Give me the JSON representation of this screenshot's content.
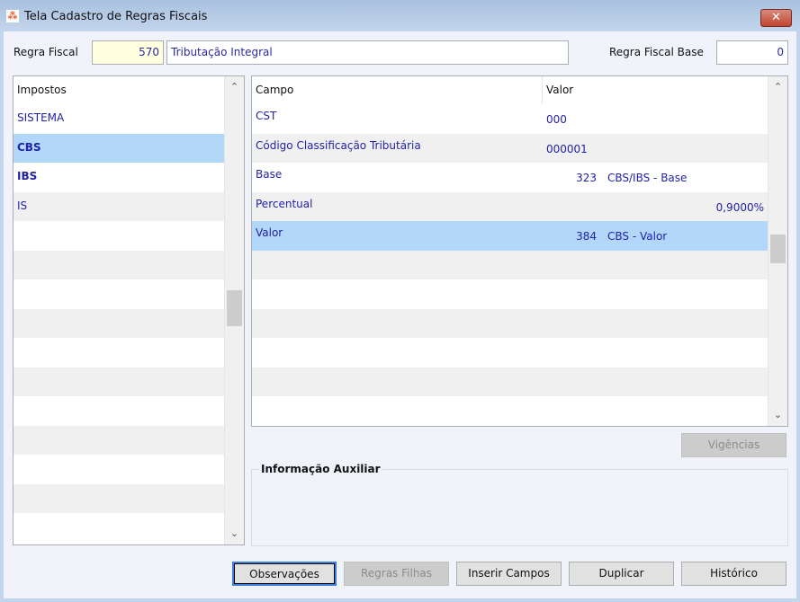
{
  "window": {
    "title": "Tela Cadastro de Regras Fiscais",
    "close_label": "✕"
  },
  "header": {
    "regra_fiscal_label": "Regra Fiscal",
    "regra_fiscal_code": "570",
    "regra_fiscal_desc": "Tributação Integral",
    "regra_base_label": "Regra Fiscal Base",
    "regra_base_value": "0"
  },
  "impostos": {
    "header": "Impostos",
    "items": [
      {
        "label": "SISTEMA",
        "bold": false
      },
      {
        "label": "CBS",
        "bold": true,
        "selected": true
      },
      {
        "label": "IBS",
        "bold": true
      },
      {
        "label": "IS",
        "bold": false
      }
    ]
  },
  "campos": {
    "col_campo": "Campo",
    "col_valor": "Valor",
    "rows": [
      {
        "campo": "CST",
        "valor": "000",
        "num": "",
        "desc": ""
      },
      {
        "campo": "Código Classificação Tributária",
        "valor": "000001",
        "num": "",
        "desc": ""
      },
      {
        "campo": "Base",
        "valor": "",
        "num": "323",
        "desc": "CBS/IBS - Base"
      },
      {
        "campo": "Percentual",
        "valor": "",
        "num": "",
        "desc": "",
        "pct": "0,9000%"
      },
      {
        "campo": "Valor",
        "valor": "",
        "num": "384",
        "desc": "CBS - Valor",
        "selected": true
      }
    ]
  },
  "buttons": {
    "vigencias": "Vigências",
    "observacoes": "Observações",
    "regras_filhas": "Regras Filhas",
    "inserir_campos": "Inserir Campos",
    "duplicar": "Duplicar",
    "historico": "Histórico"
  },
  "info": {
    "label": "Informação Auxiliar"
  }
}
